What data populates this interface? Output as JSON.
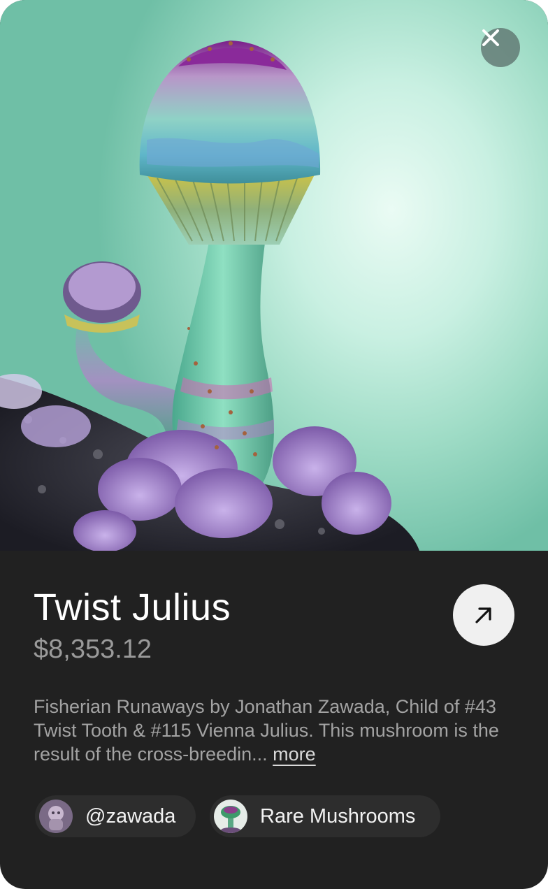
{
  "nft": {
    "title": "Twist Julius",
    "price": "$8,353.12",
    "description": "Fisherian Runaways by Jonathan Zawada, Child of #43 Twist Tooth & #115 Vienna Julius. This mushroom is the result of the cross-breedin...",
    "more_label": "more"
  },
  "chips": {
    "creator": {
      "label": "@zawada",
      "icon": "creator-avatar"
    },
    "collection": {
      "label": "Rare Mushrooms",
      "icon": "collection-avatar"
    }
  },
  "icons": {
    "close": "close-icon",
    "open": "arrow-up-right-icon"
  },
  "colors": {
    "panel_bg": "#212121",
    "title": "#ffffff",
    "price": "#9a9a9a",
    "description": "#a3a3a3",
    "chip_bg": "#2d2d2d"
  }
}
